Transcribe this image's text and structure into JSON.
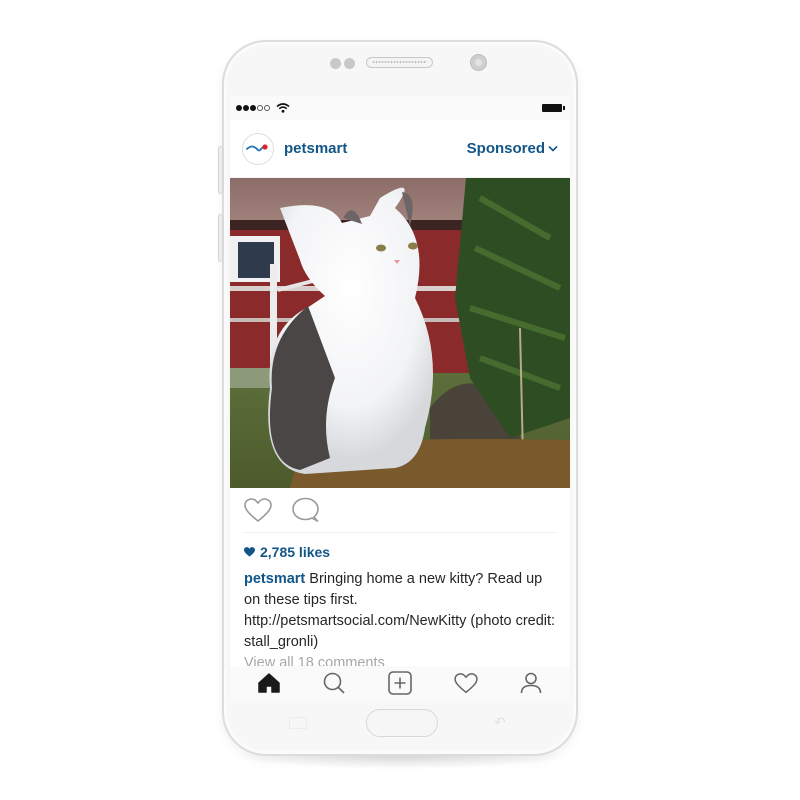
{
  "status_bar": {
    "signal_bars_filled": 3,
    "signal_bars_total": 5,
    "wifi": "wifi-icon",
    "battery": "battery-icon"
  },
  "post": {
    "account": "petsmart",
    "sponsored_label": "Sponsored",
    "sponsored_icon": "chevron-down-icon",
    "image_alt": "Fluffy white and grey cat sitting on mossy ground near a red barn and pine tree",
    "likes_icon": "heart-filled-icon",
    "likes_text": "2,785 likes",
    "caption_user": "petsmart",
    "caption_text": " Bringing home a new kitty? Read up on these tips first. http://petsmartsocial.com/NewKitty (photo credit: stall_gronli)",
    "view_comments": "View all 18 comments",
    "actions": [
      {
        "name": "like",
        "icon": "heart-outline-icon"
      },
      {
        "name": "comment",
        "icon": "comment-icon"
      }
    ]
  },
  "tabbar": {
    "items": [
      {
        "name": "home",
        "icon": "home-icon",
        "active": true
      },
      {
        "name": "search",
        "icon": "search-icon",
        "active": false
      },
      {
        "name": "add",
        "icon": "add-post-icon",
        "active": false
      },
      {
        "name": "activity",
        "icon": "heart-outline-icon",
        "active": false
      },
      {
        "name": "profile",
        "icon": "profile-icon",
        "active": false
      }
    ]
  },
  "colors": {
    "link_blue": "#125688",
    "muted_grey": "#a5a7aa",
    "text": "#262626",
    "logo_red": "#d9262c",
    "logo_blue": "#1f74b8"
  }
}
